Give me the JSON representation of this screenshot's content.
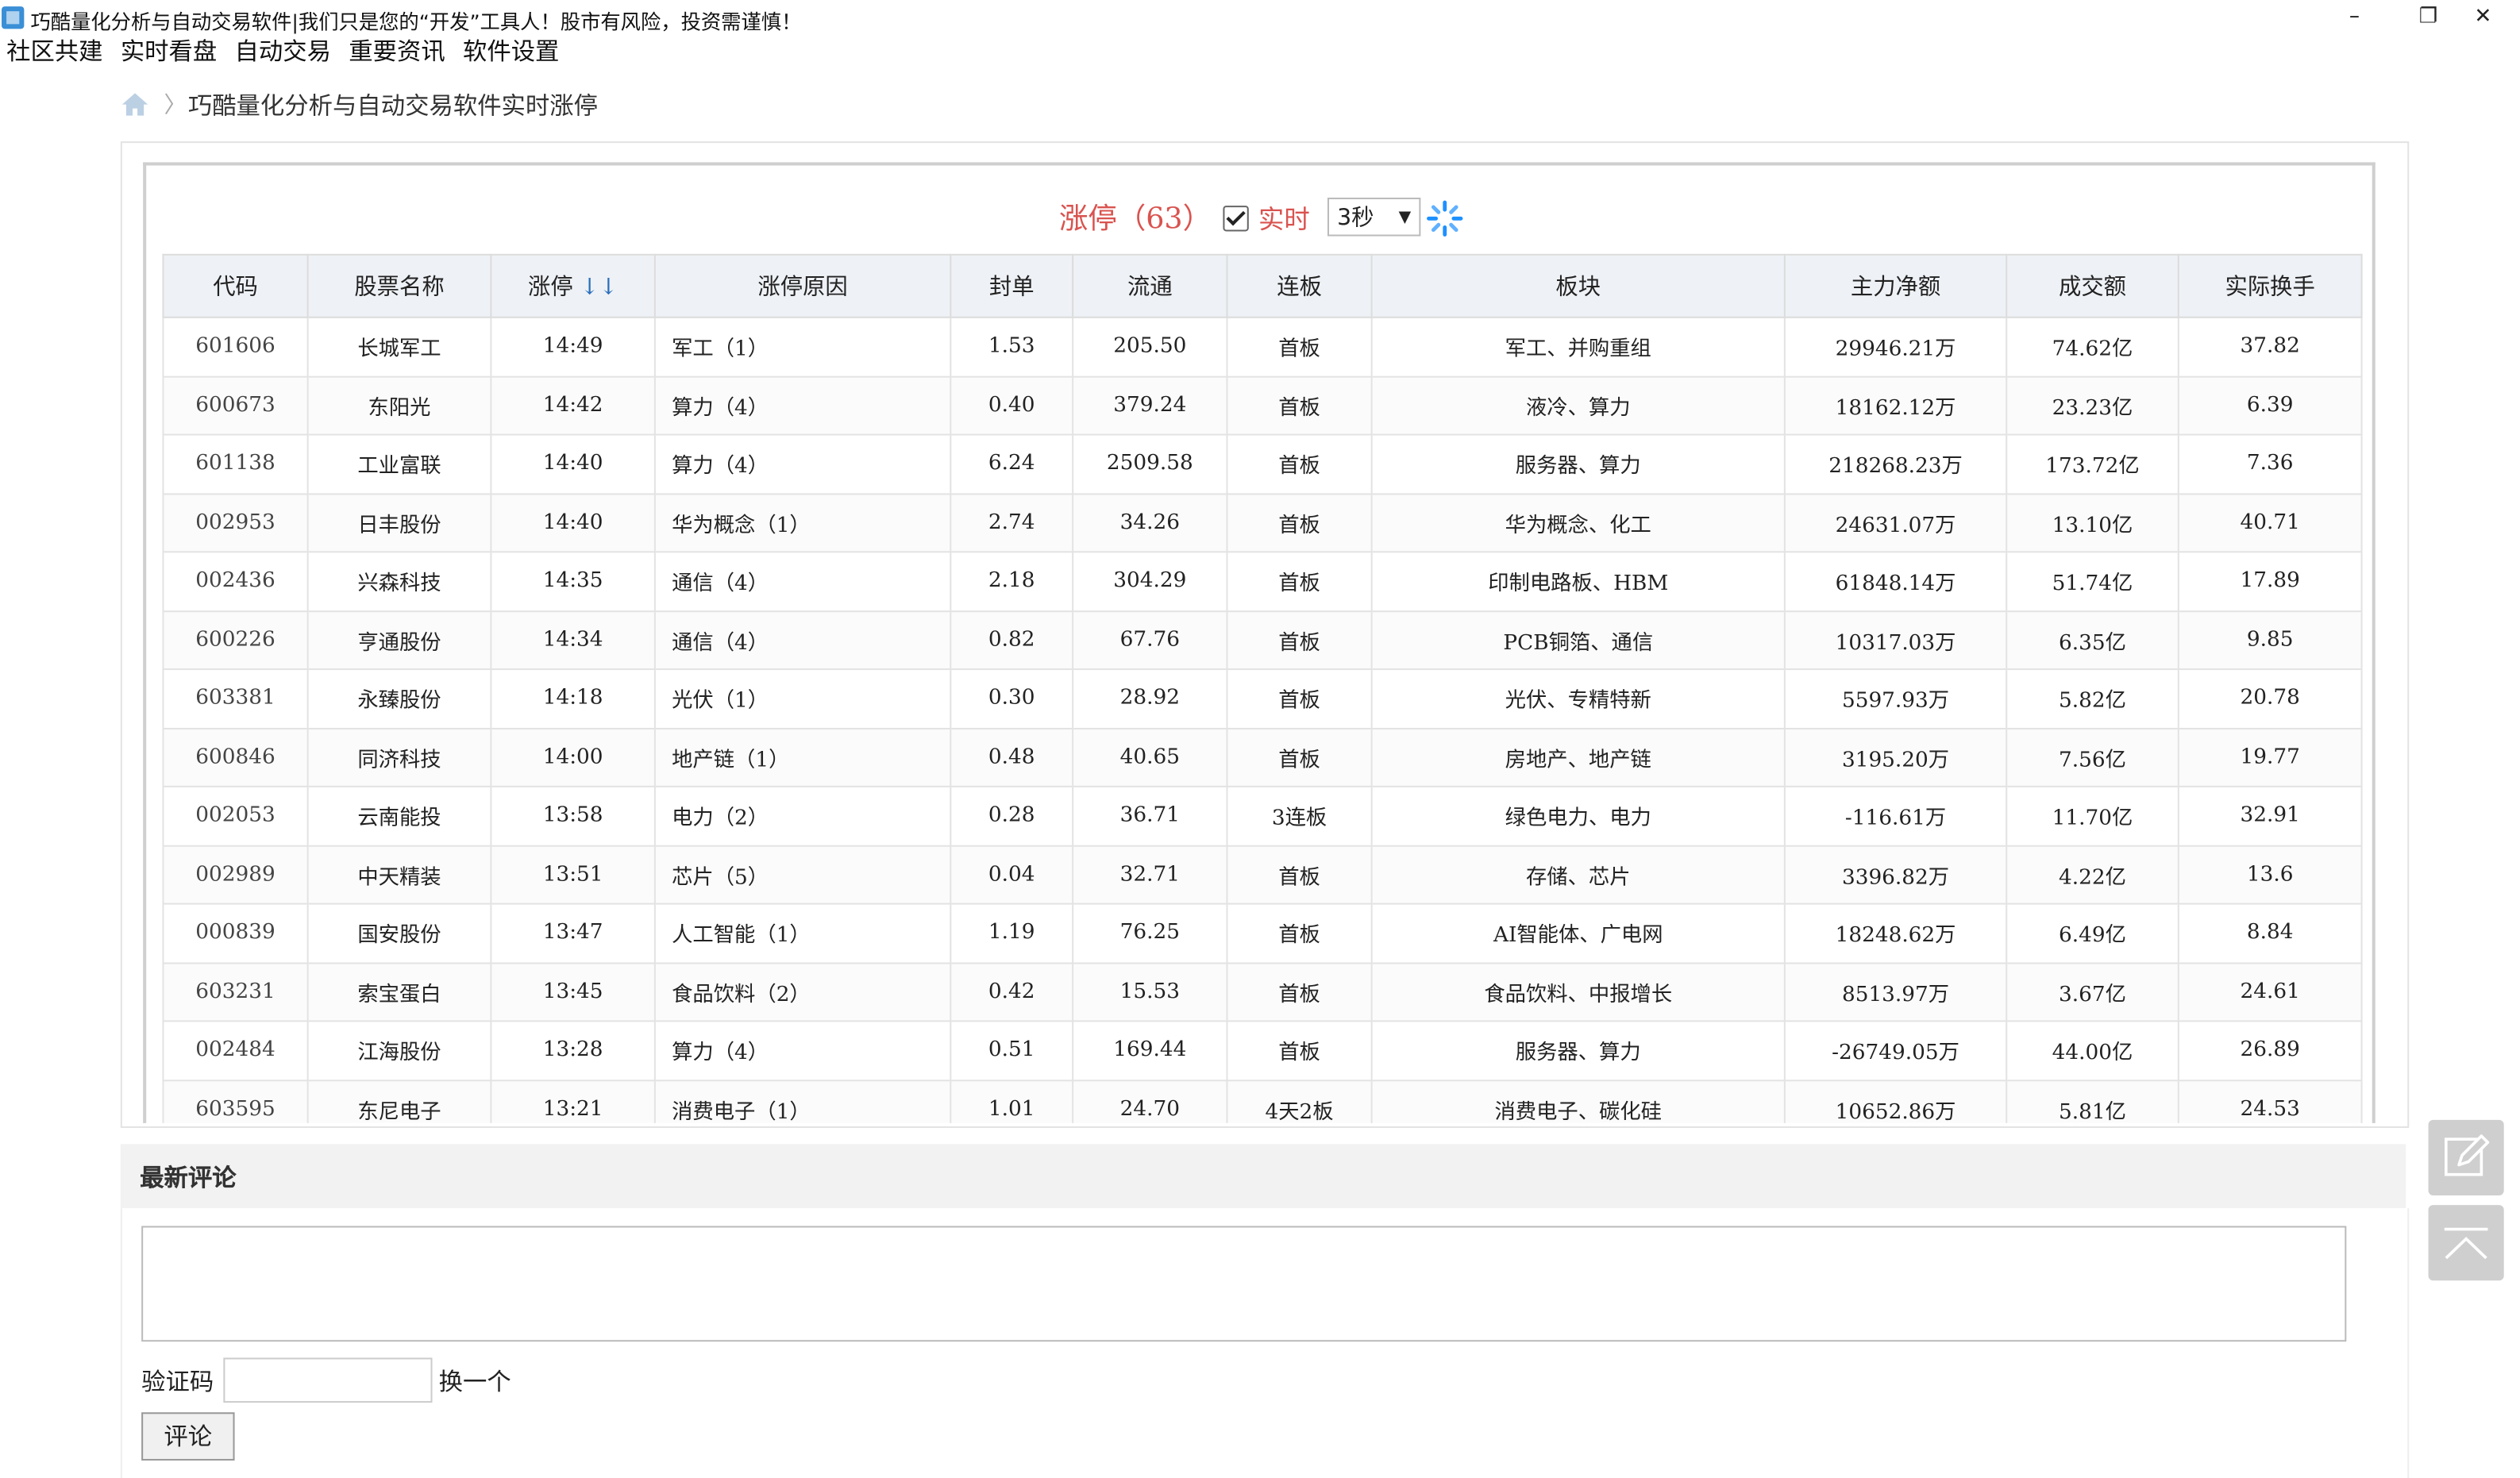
{
  "window": {
    "title": "巧酷量化分析与自动交易软件|我们只是您的“开发”工具人！股市有风险，投资需谨慎！",
    "minimize": "–",
    "maximize": "❐",
    "close": "✕"
  },
  "menu": [
    "社区共建",
    "实时看盘",
    "自动交易",
    "重要资讯",
    "软件设置"
  ],
  "breadcrumb": {
    "separator": "〉",
    "page": "巧酷量化分析与自动交易软件实时涨停"
  },
  "heading": {
    "title": "涨停（63）",
    "live_label": "实时",
    "live_checked": true,
    "interval": "3秒",
    "interval_arrow": "▼"
  },
  "table": {
    "headers": [
      "代码",
      "股票名称",
      "涨停",
      "涨停原因",
      "封单",
      "流通",
      "连板",
      "板块",
      "主力净额",
      "成交额",
      "实际换手"
    ],
    "sort_indicator": "↓↓",
    "rows": [
      [
        "601606",
        "长城军工",
        "14:49",
        "军工（1）",
        "1.53",
        "205.50",
        "首板",
        "军工、并购重组",
        "29946.21万",
        "74.62亿",
        "37.82"
      ],
      [
        "600673",
        "东阳光",
        "14:42",
        "算力（4）",
        "0.40",
        "379.24",
        "首板",
        "液冷、算力",
        "18162.12万",
        "23.23亿",
        "6.39"
      ],
      [
        "601138",
        "工业富联",
        "14:40",
        "算力（4）",
        "6.24",
        "2509.58",
        "首板",
        "服务器、算力",
        "218268.23万",
        "173.72亿",
        "7.36"
      ],
      [
        "002953",
        "日丰股份",
        "14:40",
        "华为概念（1）",
        "2.74",
        "34.26",
        "首板",
        "华为概念、化工",
        "24631.07万",
        "13.10亿",
        "40.71"
      ],
      [
        "002436",
        "兴森科技",
        "14:35",
        "通信（4）",
        "2.18",
        "304.29",
        "首板",
        "印制电路板、HBM",
        "61848.14万",
        "51.74亿",
        "17.89"
      ],
      [
        "600226",
        "亨通股份",
        "14:34",
        "通信（4）",
        "0.82",
        "67.76",
        "首板",
        "PCB铜箔、通信",
        "10317.03万",
        "6.35亿",
        "9.85"
      ],
      [
        "603381",
        "永臻股份",
        "14:18",
        "光伏（1）",
        "0.30",
        "28.92",
        "首板",
        "光伏、专精特新",
        "5597.93万",
        "5.82亿",
        "20.78"
      ],
      [
        "600846",
        "同济科技",
        "14:00",
        "地产链（1）",
        "0.48",
        "40.65",
        "首板",
        "房地产、地产链",
        "3195.20万",
        "7.56亿",
        "19.77"
      ],
      [
        "002053",
        "云南能投",
        "13:58",
        "电力（2）",
        "0.28",
        "36.71",
        "3连板",
        "绿色电力、电力",
        "-116.61万",
        "11.70亿",
        "32.91"
      ],
      [
        "002989",
        "中天精装",
        "13:51",
        "芯片（5）",
        "0.04",
        "32.71",
        "首板",
        "存储、芯片",
        "3396.82万",
        "4.22亿",
        "13.6"
      ],
      [
        "000839",
        "国安股份",
        "13:47",
        "人工智能（1）",
        "1.19",
        "76.25",
        "首板",
        "AI智能体、广电网",
        "18248.62万",
        "6.49亿",
        "8.84"
      ],
      [
        "603231",
        "索宝蛋白",
        "13:45",
        "食品饮料（2）",
        "0.42",
        "15.53",
        "首板",
        "食品饮料、中报增长",
        "8513.97万",
        "3.67亿",
        "24.61"
      ],
      [
        "002484",
        "江海股份",
        "13:28",
        "算力（4）",
        "0.51",
        "169.44",
        "首板",
        "服务器、算力",
        "-26749.05万",
        "44.00亿",
        "26.89"
      ],
      [
        "603595",
        "东尼电子",
        "13:21",
        "消费电子（1）",
        "1.01",
        "24.70",
        "4天2板",
        "消费电子、碳化硅",
        "10652.86万",
        "5.81亿",
        "24.53"
      ]
    ]
  },
  "comments": {
    "title": "最新评论",
    "captcha_label": "验证码",
    "captcha_refresh": "换一个",
    "submit": "评论"
  },
  "colors": {
    "accent_red": "#d9534f",
    "sort_blue": "#2a6ebd",
    "spinner_blue": "#1e90ff"
  }
}
